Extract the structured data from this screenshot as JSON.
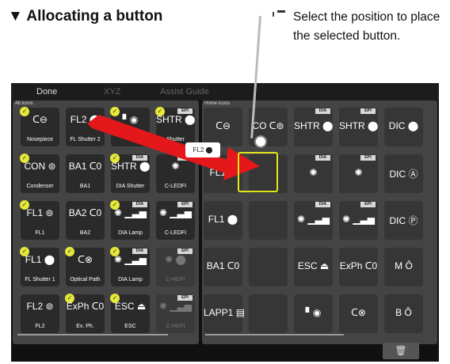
{
  "heading": "▼ Allocating a button",
  "callout": "Select the position to place the selected button.",
  "topbar": {
    "done": "Done",
    "xyz": "XYZ",
    "assist": "Assist Guide"
  },
  "left_panel": {
    "label": "All Icons",
    "tiles": [
      {
        "icon": "ᑕ⊖",
        "name": "Nosepiece",
        "check": "✓",
        "badge": "",
        "dim": false
      },
      {
        "icon": "FL2 ⬤",
        "name": "FL Shutter 2",
        "check": "",
        "badge": "",
        "dim": false
      },
      {
        "icon": "▘◉",
        "name": "",
        "check": "✓",
        "badge": "",
        "dim": false
      },
      {
        "icon": "SHTR ⬤",
        "name": "Shutter",
        "check": "✓",
        "badge": "EPI",
        "dim": false
      },
      {
        "icon": "CON ⊚",
        "name": "Condenser",
        "check": "✓",
        "badge": "",
        "dim": false
      },
      {
        "icon": "BA1 ᑕ0",
        "name": "BA1",
        "check": "",
        "badge": "",
        "dim": false
      },
      {
        "icon": "SHTR ⬤",
        "name": "DIA Shutter",
        "check": "✓",
        "badge": "DIA",
        "dim": false
      },
      {
        "icon": "✺",
        "name": "C-LEDFI",
        "check": "",
        "badge": "EPI",
        "dim": false
      },
      {
        "icon": "FL1 ⊚",
        "name": "FL1",
        "check": "✓",
        "badge": "",
        "dim": false
      },
      {
        "icon": "BA2 ᑕ0",
        "name": "BA2",
        "check": "",
        "badge": "",
        "dim": false
      },
      {
        "icon": "✺ ▁▃▅",
        "name": "DIA Lamp",
        "check": "✓",
        "badge": "DIA",
        "dim": false
      },
      {
        "icon": "✺ ▁▃▅",
        "name": "C-LEDFI",
        "check": "",
        "badge": "EPI",
        "dim": false
      },
      {
        "icon": "FL1 ⬤",
        "name": "FL Shutter 1",
        "check": "✓",
        "badge": "",
        "dim": false
      },
      {
        "icon": "ᑕ⊗",
        "name": "Optical Path",
        "check": "✓",
        "badge": "",
        "dim": false
      },
      {
        "icon": "✺ ▁▃▅",
        "name": "DIA Lamp",
        "check": "✓",
        "badge": "DIA",
        "dim": false
      },
      {
        "icon": "✺ ⬤",
        "name": "C-HGFI",
        "check": "",
        "badge": "EPI",
        "dim": true
      },
      {
        "icon": "FL2 ⊚",
        "name": "FL2",
        "check": "",
        "badge": "",
        "dim": false
      },
      {
        "icon": "ExPh ᑕ0",
        "name": "Ex. Ph.",
        "check": "✓",
        "badge": "",
        "dim": false
      },
      {
        "icon": "ESC ⏏",
        "name": "ESC",
        "check": "✓",
        "badge": "",
        "dim": false
      },
      {
        "icon": "✺ ▁▃▅",
        "name": "C-HGFI",
        "check": "",
        "badge": "EPI",
        "dim": true
      }
    ]
  },
  "right_panel": {
    "label": "Home Icons",
    "tiles": [
      {
        "icon": "ᑕ⊖",
        "badge": ""
      },
      {
        "icon": "CO ᑕ⊚",
        "badge": ""
      },
      {
        "icon": "SHTR ⬤",
        "badge": "DIA"
      },
      {
        "icon": "SHTR ⬤",
        "badge": "EPI"
      },
      {
        "icon": "DIC ⬤",
        "badge": ""
      },
      {
        "icon": "FL1 ⊚",
        "badge": ""
      },
      {
        "icon": "",
        "badge": ""
      },
      {
        "icon": "✺",
        "badge": "DIA"
      },
      {
        "icon": "✺",
        "badge": "EPI"
      },
      {
        "icon": "DIC Ⓐ",
        "badge": ""
      },
      {
        "icon": "FL1 ⬤",
        "badge": ""
      },
      {
        "icon": "",
        "badge": ""
      },
      {
        "icon": "✺ ▁▃▅",
        "badge": "DIA"
      },
      {
        "icon": "✺ ▁▃▅",
        "badge": "EPI"
      },
      {
        "icon": "DIC Ⓟ",
        "badge": ""
      },
      {
        "icon": "BA1 ᑕ0",
        "badge": ""
      },
      {
        "icon": "",
        "badge": ""
      },
      {
        "icon": "ESC ⏏",
        "badge": ""
      },
      {
        "icon": "ExPh ᑕ0",
        "badge": ""
      },
      {
        "icon": "M Ô",
        "badge": ""
      },
      {
        "icon": "LAPP1 ▤",
        "badge": ""
      },
      {
        "icon": "",
        "badge": ""
      },
      {
        "icon": "▘◉",
        "badge": ""
      },
      {
        "icon": "ᑕ⊗",
        "badge": ""
      },
      {
        "icon": "B Ô",
        "badge": ""
      }
    ]
  },
  "dragged_button": "FL2 ⬤",
  "trash_icon": "🗑",
  "colors": {
    "selection": "#e4e61c",
    "arrow": "#e4171b",
    "check": "#e6e83a"
  }
}
